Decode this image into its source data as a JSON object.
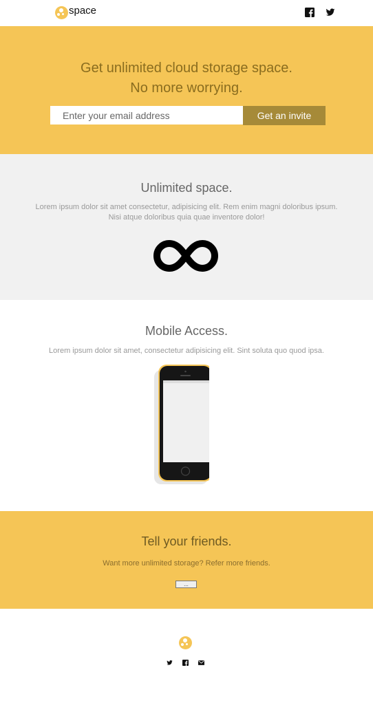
{
  "header": {
    "brand": "space",
    "icons": [
      "space-logo-icon",
      "facebook-icon",
      "twitter-icon"
    ]
  },
  "hero": {
    "headline_line1": "Get unlimited cloud storage space.",
    "headline_line2": "No more worrying.",
    "email_placeholder": "Enter your email address",
    "email_value": "",
    "invite_label": "Get an invite"
  },
  "unlimited": {
    "title": "Unlimited space.",
    "text_line1": "Lorem ipsum dolor sit amet consectetur, adipisicing elit. Rem enim magni doloribus ipsum.",
    "text_line2": "Nisi atque doloribus quia quae inventore dolor!",
    "icon": "infinity-icon"
  },
  "mobile": {
    "title": "Mobile Access.",
    "text": "Lorem ipsum dolor sit amet, consectetur adipisicing elit. Sint soluta quo quod ipsa.",
    "image": "yellow-smartphone"
  },
  "friends": {
    "title": "Tell your friends.",
    "text": "Want more unlimited storage? Refer more friends.",
    "button_label": "..."
  },
  "footer": {
    "icons": [
      "space-logo-icon",
      "twitter-icon",
      "facebook-icon",
      "mail-icon"
    ]
  },
  "colors": {
    "accent": "#f5c556",
    "button": "#a68a38",
    "section_gray": "#f1f1f1"
  }
}
